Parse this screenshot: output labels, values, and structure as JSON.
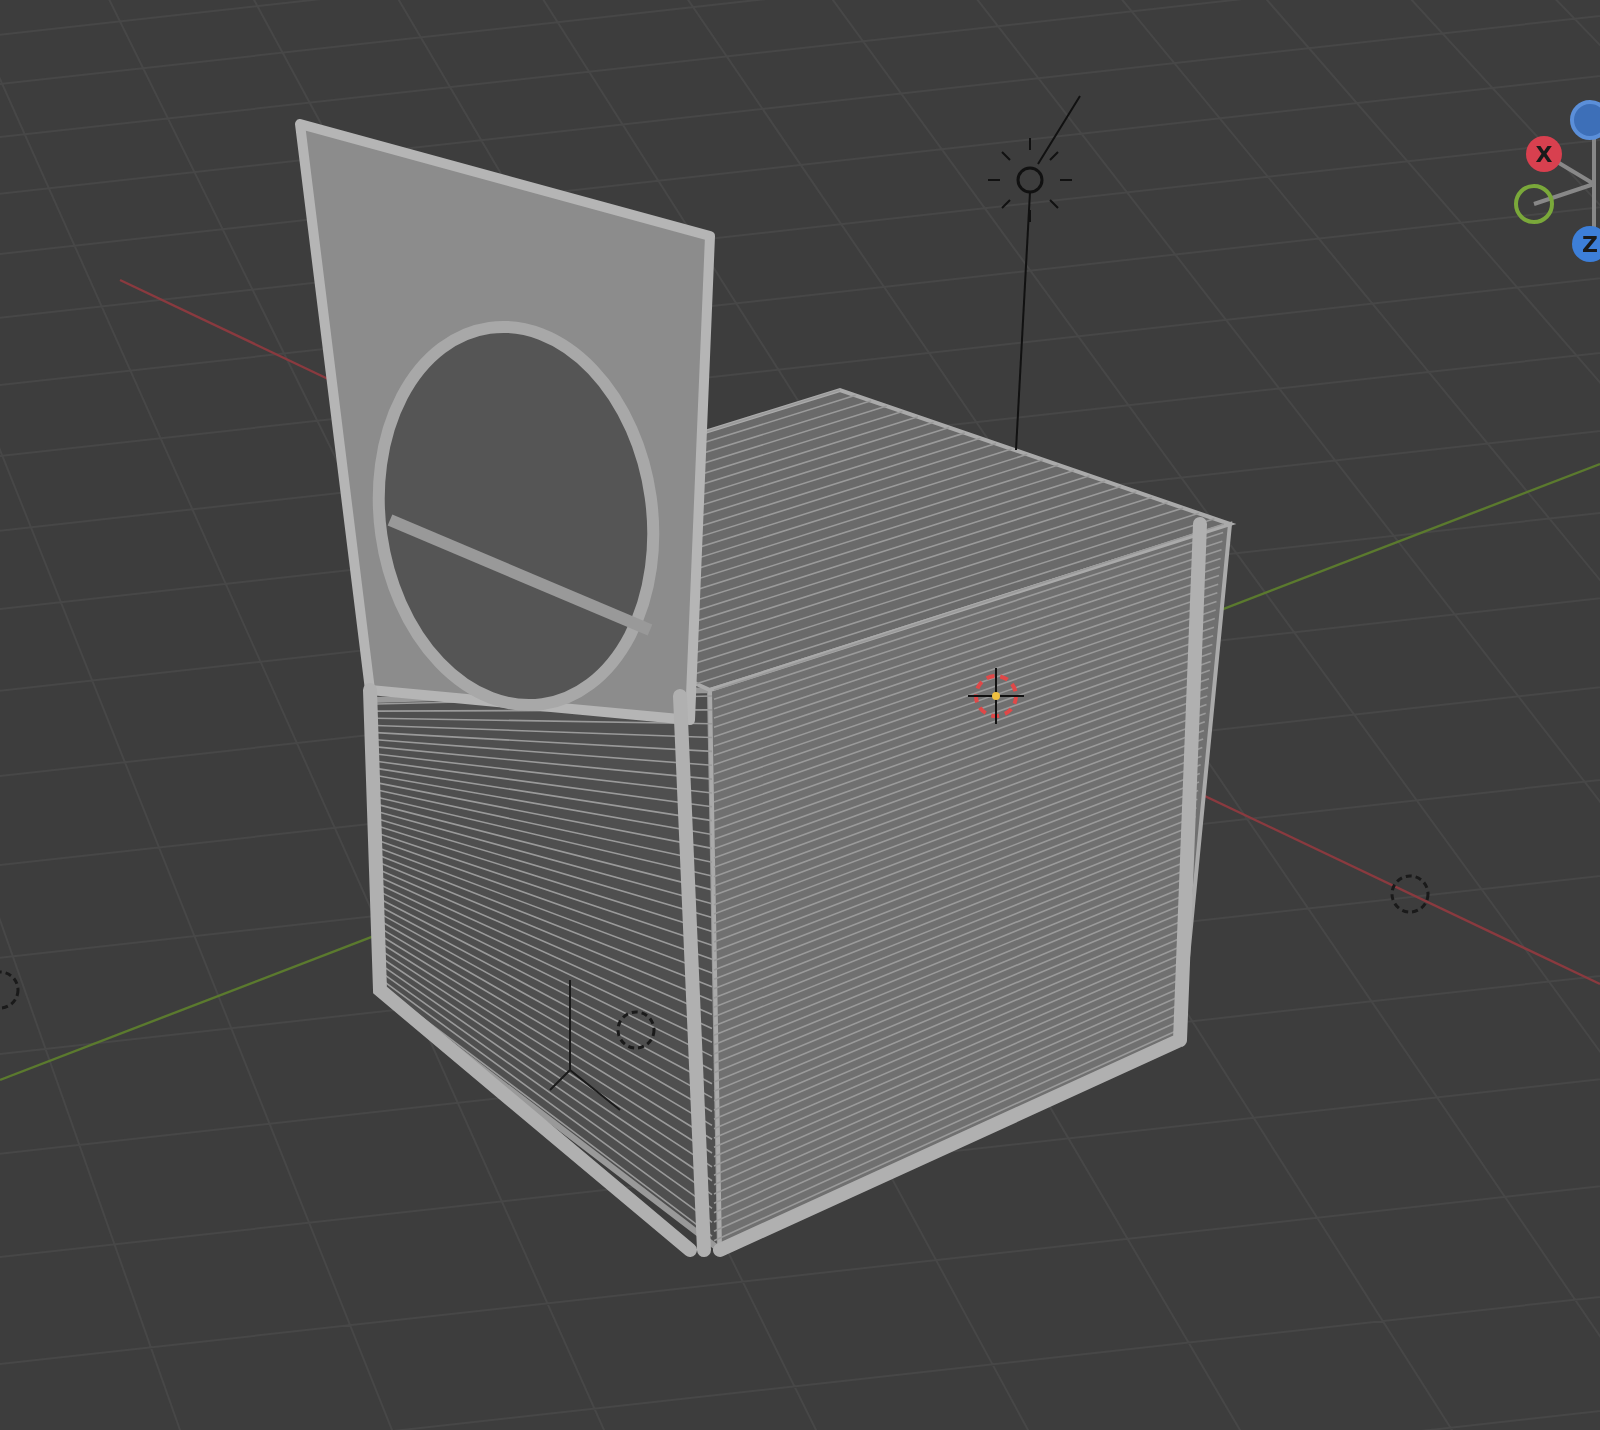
{
  "viewport": {
    "navigation_gizmo": {
      "axes": [
        {
          "kind": "negative",
          "color": "#3d6fb8"
        },
        {
          "kind": "positive",
          "label": "X",
          "color": "#d8404f"
        },
        {
          "kind": "ring",
          "color": "#7aa83a"
        },
        {
          "kind": "positive",
          "label": "Z",
          "color": "#3d7fd9"
        }
      ]
    }
  }
}
